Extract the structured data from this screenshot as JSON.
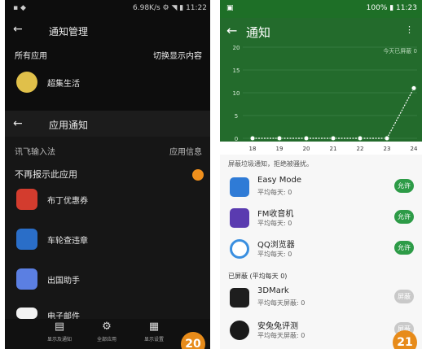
{
  "left": {
    "status": {
      "left": "▪ ◆",
      "right": "6.98K/s ⚙ ◥ ▮ 11:22"
    },
    "header_title": "通知管理",
    "all_apps_label": "所有应用",
    "switch_display_label": "切换显示内容",
    "app1_label": "超集生活",
    "overlay_title": "应用通知",
    "overlay_app_label": "讯飞输入法",
    "overlay_app_info": "应用信息",
    "no_more_label": "不再报示此应用",
    "app_list": [
      {
        "label": "布丁优惠券"
      },
      {
        "label": "车轮查违章"
      },
      {
        "label": "出国助手"
      },
      {
        "label": "电子邮件"
      }
    ],
    "bottom_nav": [
      {
        "label": "显示及通知",
        "icon": "chart-icon"
      },
      {
        "label": "全部应用",
        "icon": "gear-icon"
      },
      {
        "label": "显示设置",
        "icon": "grid-icon"
      }
    ],
    "badge": "20"
  },
  "right": {
    "status": {
      "left": "▣",
      "right": "100% ▮ 11:23"
    },
    "title": "通知",
    "more": "⋮",
    "today_label": "今天已屏蔽 0",
    "notice": "屏蔽垃圾通知，拒绝被骚扰。",
    "items_allowed": [
      {
        "name": "Easy Mode",
        "sub": "平均每天: 0",
        "btn": "允许"
      },
      {
        "name": "FM收音机",
        "sub": "平均每天: 0",
        "btn": "允许"
      },
      {
        "name": "QQ浏览器",
        "sub": "平均每天: 0",
        "btn": "允许"
      }
    ],
    "blocked_header": "已屏蔽 (平均每天 0)",
    "items_blocked": [
      {
        "name": "3DMark",
        "sub": "平均每天屏蔽: 0",
        "btn": "屏蔽"
      },
      {
        "name": "安兔兔评测",
        "sub": "平均每天屏蔽: 0",
        "btn": "屏蔽"
      }
    ],
    "badge": "21",
    "colors": {
      "header": "#236b2c",
      "allow": "#2d9b47",
      "block": "#c9c9c9"
    }
  },
  "chart_data": {
    "type": "line",
    "categories": [
      "18",
      "19",
      "20",
      "21",
      "22",
      "23",
      "24"
    ],
    "x": [
      "18",
      "19",
      "20",
      "21",
      "22",
      "23",
      "24"
    ],
    "y_ticks": [
      "0",
      "5",
      "10",
      "15",
      "20"
    ],
    "series": [
      {
        "values": [
          0,
          0,
          0,
          0,
          0,
          0,
          11
        ]
      }
    ],
    "ylim": [
      0,
      20
    ],
    "grid": true,
    "title": "",
    "xlabel": "",
    "ylabel": ""
  }
}
